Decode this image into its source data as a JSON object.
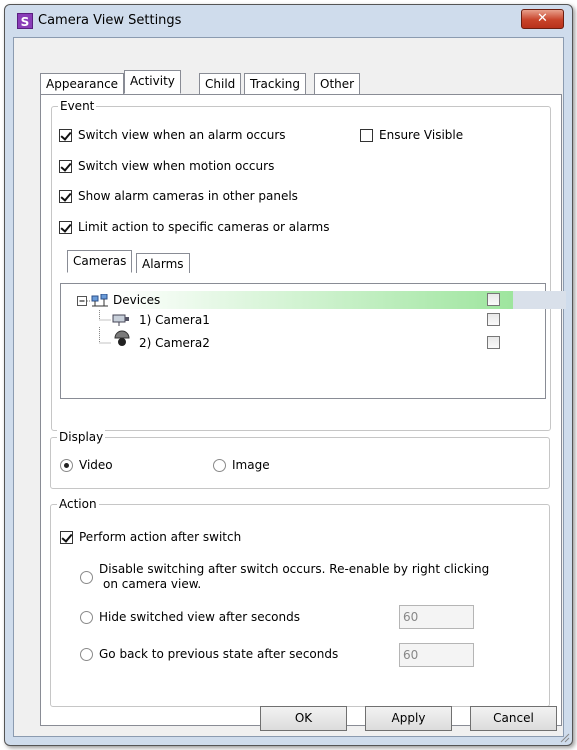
{
  "window": {
    "title": "Camera View Settings",
    "app_icon": "S",
    "close_glyph": "✕"
  },
  "tabs": [
    {
      "label": "Appearance"
    },
    {
      "label": "Activity"
    },
    {
      "label": "Child"
    },
    {
      "label": "Tracking"
    },
    {
      "label": "Other"
    }
  ],
  "active_tab": "Activity",
  "event": {
    "legend": "Event",
    "switch_on_alarm": {
      "label": "Switch view when an alarm occurs",
      "checked": true
    },
    "ensure_visible": {
      "label": "Ensure Visible",
      "checked": false
    },
    "switch_on_motion": {
      "label": "Switch view when motion occurs",
      "checked": true
    },
    "show_alarm_cameras": {
      "label": "Show alarm cameras in other panels",
      "checked": true
    },
    "limit_action": {
      "label": "Limit action to specific cameras or alarms",
      "checked": true
    },
    "subtabs": [
      {
        "label": "Cameras"
      },
      {
        "label": "Alarms"
      }
    ],
    "tree": [
      {
        "label": "Devices",
        "icon": "network-devices-icon",
        "checked": false
      },
      {
        "label": "1) Camera1",
        "icon": "box-camera-icon",
        "checked": false
      },
      {
        "label": "2) Camera2",
        "icon": "dome-camera-icon",
        "checked": false
      }
    ]
  },
  "display": {
    "legend": "Display",
    "video": {
      "label": "Video",
      "selected": true
    },
    "image": {
      "label": "Image",
      "selected": false
    }
  },
  "action": {
    "legend": "Action",
    "perform_after_switch": {
      "label": "Perform action after switch",
      "checked": true
    },
    "disable_switching": {
      "label_line1": "Disable switching after switch occurs.  Re-enable by right clicking",
      "label_line2": "on camera view.",
      "selected": false
    },
    "hide_view": {
      "label": "Hide switched view after seconds",
      "selected": false,
      "value": "60"
    },
    "go_back": {
      "label": "Go back to previous state after seconds",
      "selected": false,
      "value": "60"
    }
  },
  "buttons": {
    "ok": "OK",
    "apply": "Apply",
    "cancel": "Cancel"
  },
  "colors": {
    "title_bg": "#cfdcec",
    "close_red": "#c8432a",
    "highlight_green": "#9ee59e"
  }
}
